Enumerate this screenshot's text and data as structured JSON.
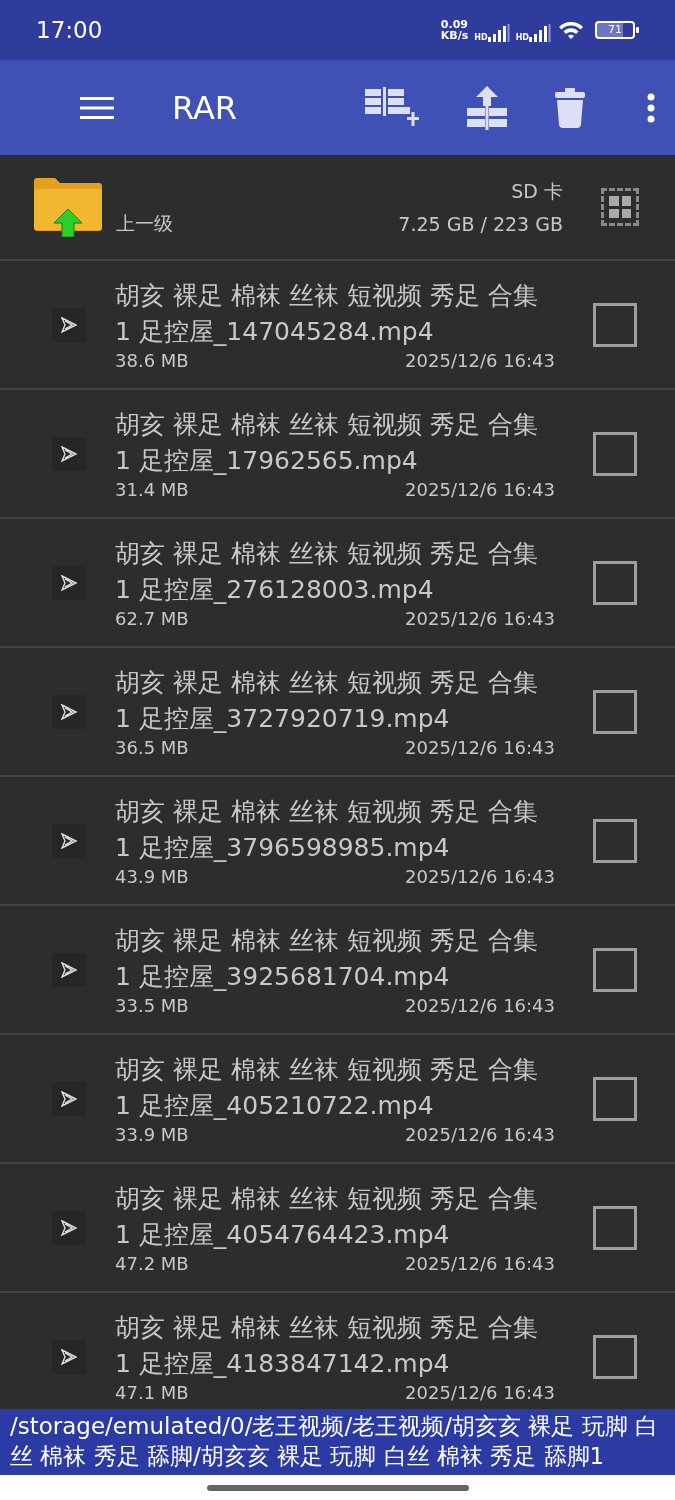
{
  "status_bar": {
    "time": "17:00",
    "net_speed_value": "0.09",
    "net_speed_unit": "KB/s",
    "sim_labels": [
      "HD",
      "HD"
    ],
    "battery": "71"
  },
  "toolbar": {
    "title": "RAR"
  },
  "header": {
    "parent_label": "上一级",
    "storage_name": "SD 卡",
    "storage_usage": "7.25 GB / 223 GB"
  },
  "files": [
    {
      "name": "胡亥 裸足 棉袜 丝袜 短视频 秀足 合集 1 足控屋_147045284.mp4",
      "size": "38.6 MB",
      "date": "2025/12/6 16:43",
      "checked": false
    },
    {
      "name": "胡亥 裸足 棉袜 丝袜 短视频 秀足 合集 1 足控屋_17962565.mp4",
      "size": "31.4 MB",
      "date": "2025/12/6 16:43",
      "checked": false
    },
    {
      "name": "胡亥 裸足 棉袜 丝袜 短视频 秀足 合集 1 足控屋_276128003.mp4",
      "size": "62.7 MB",
      "date": "2025/12/6 16:43",
      "checked": false
    },
    {
      "name": "胡亥 裸足 棉袜 丝袜 短视频 秀足 合集 1 足控屋_3727920719.mp4",
      "size": "36.5 MB",
      "date": "2025/12/6 16:43",
      "checked": false
    },
    {
      "name": "胡亥 裸足 棉袜 丝袜 短视频 秀足 合集 1 足控屋_3796598985.mp4",
      "size": "43.9 MB",
      "date": "2025/12/6 16:43",
      "checked": false
    },
    {
      "name": "胡亥 裸足 棉袜 丝袜 短视频 秀足 合集 1 足控屋_3925681704.mp4",
      "size": "33.5 MB",
      "date": "2025/12/6 16:43",
      "checked": false
    },
    {
      "name": "胡亥 裸足 棉袜 丝袜 短视频 秀足 合集 1 足控屋_405210722.mp4",
      "size": "33.9 MB",
      "date": "2025/12/6 16:43",
      "checked": false
    },
    {
      "name": "胡亥 裸足 棉袜 丝袜 短视频 秀足 合集 1 足控屋_4054764423.mp4",
      "size": "47.2 MB",
      "date": "2025/12/6 16:43",
      "checked": false
    },
    {
      "name": "胡亥 裸足 棉袜 丝袜 短视频 秀足 合集 1 足控屋_4183847142.mp4",
      "size": "47.1 MB",
      "date": "2025/12/6 16:43",
      "checked": false
    }
  ],
  "path": "/storage/emulated/0/老王视频/老王视频/胡亥亥 裸足 玩脚 白丝 棉袜 秀足 舔脚/胡亥亥 裸足 玩脚 白丝 棉袜 秀足 舔脚1"
}
